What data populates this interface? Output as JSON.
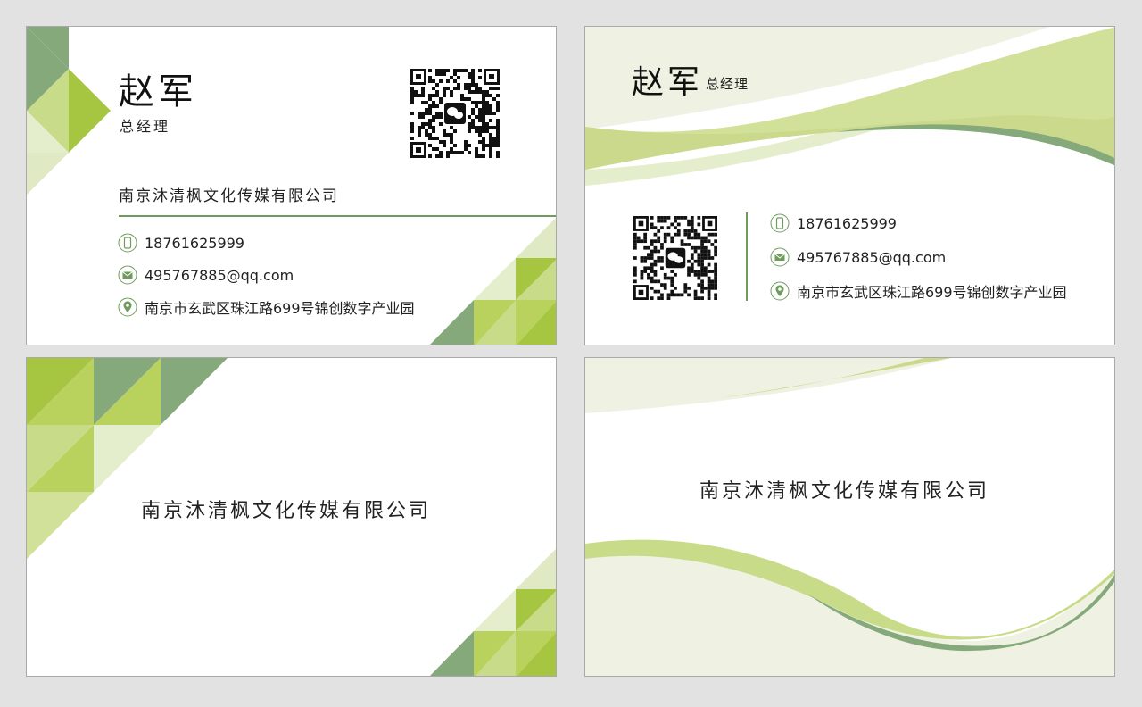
{
  "front": {
    "name": "赵军",
    "position": "总经理",
    "company": "南京沐清枫文化传媒有限公司"
  },
  "contact": {
    "phone": "18761625999",
    "email": "495767885@qq.com",
    "address": "南京市玄武区珠江路699号锦创数字产业园"
  },
  "back": {
    "company": "南京沐清枫文化传媒有限公司"
  },
  "icons": {
    "phone": "phone-icon",
    "email": "mail-icon",
    "address": "location-pin-icon",
    "qr_center": "wechat-icon"
  },
  "colors": {
    "dark_green": "#85a97a",
    "lime": "#a6c540",
    "light_lime": "#c8db88",
    "pale": "#e4edcc",
    "cream": "#eff2e2",
    "line": "#6f9c5d"
  }
}
